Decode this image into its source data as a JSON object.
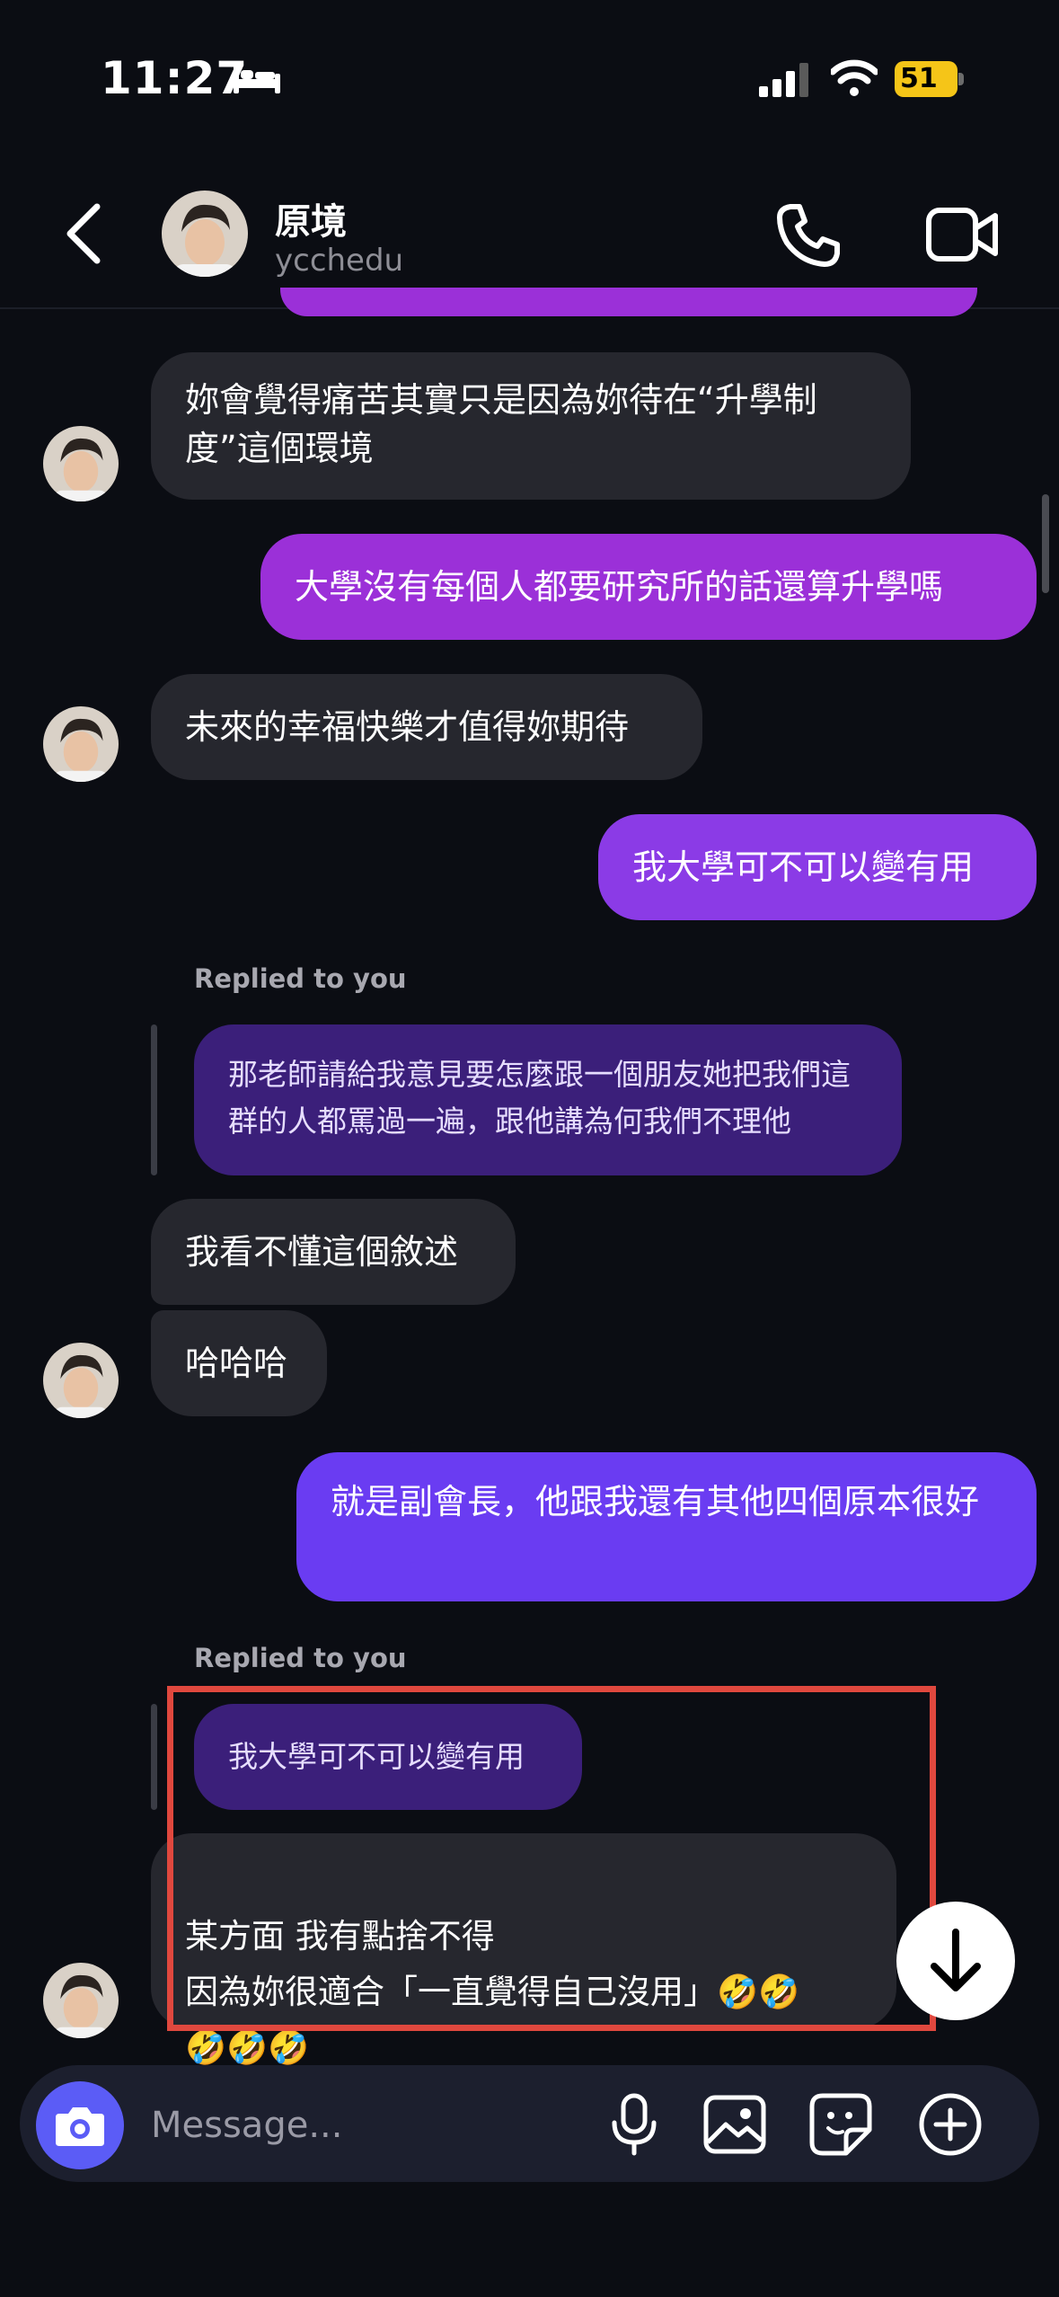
{
  "status_bar": {
    "time": "11:27",
    "battery": "51"
  },
  "header": {
    "name": "原境",
    "username": "ycchedu"
  },
  "messages": [
    {
      "dir": "in",
      "text": "妳會覺得痛苦其實只是因為妳待在“升學制度”這個環境"
    },
    {
      "dir": "out",
      "text": "大學沒有每個人都要研究所的話還算升學嗎"
    },
    {
      "dir": "in",
      "text": "未來的幸福快樂才值得妳期待"
    },
    {
      "dir": "out",
      "text": "我大學可不可以變有用"
    },
    {
      "dir": "in",
      "replied_label": "Replied to you",
      "quoted": "那老師請給我意見要怎麼跟一個朋友她把我們這群的人都罵過一遍，跟他講為何我們不理他",
      "text": "我看不懂這個敘述"
    },
    {
      "dir": "in",
      "text": "哈哈哈"
    },
    {
      "dir": "out",
      "text": "就是副會長，他跟我還有其他四個原本很好"
    },
    {
      "dir": "in",
      "replied_label": "Replied to you",
      "quoted": "我大學可不可以變有用",
      "text": "某方面 我有點捨不得\n因為妳很適合「一直覺得自己沒用」🤣🤣\n🤣🤣🤣"
    }
  ],
  "composer": {
    "placeholder": "Message..."
  },
  "colors": {
    "outgoing_top": "#9b30d8",
    "outgoing_bottom": "#6a3cf2",
    "incoming": "#26272e",
    "highlight": "#e0483e",
    "camera": "#5b5cf6"
  },
  "icons": [
    "bed-icon",
    "signal-icon",
    "wifi-icon",
    "battery-icon",
    "back-icon",
    "phone-icon",
    "video-icon",
    "camera-icon",
    "microphone-icon",
    "image-icon",
    "sticker-icon",
    "plus-icon",
    "arrow-down-icon"
  ]
}
